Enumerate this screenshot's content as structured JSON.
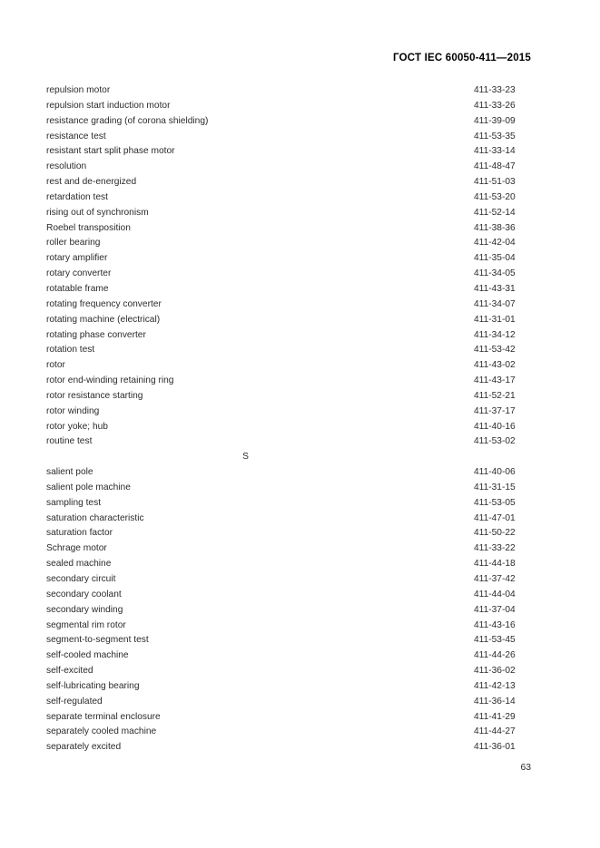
{
  "header": {
    "standard_title": "ГОСТ IEC 60050-411—2015"
  },
  "footer": {
    "page_number": "63"
  },
  "index": {
    "blocks": [
      {
        "letter": null,
        "entries": [
          {
            "term": "repulsion motor",
            "ref": "411-33-23"
          },
          {
            "term": "repulsion start induction motor",
            "ref": "411-33-26"
          },
          {
            "term": "resistance grading (of corona shielding)",
            "ref": "411-39-09"
          },
          {
            "term": "resistance test",
            "ref": "411-53-35"
          },
          {
            "term": "resistant start split phase motor",
            "ref": "411-33-14"
          },
          {
            "term": "resolution",
            "ref": "411-48-47"
          },
          {
            "term": "rest and de-energized",
            "ref": "411-51-03"
          },
          {
            "term": "retardation test",
            "ref": "411-53-20"
          },
          {
            "term": "rising out of synchronism",
            "ref": "411-52-14"
          },
          {
            "term": "Roebel transposition",
            "ref": "411-38-36"
          },
          {
            "term": "roller bearing",
            "ref": "411-42-04"
          },
          {
            "term": "rotary amplifier",
            "ref": "411-35-04"
          },
          {
            "term": "rotary converter",
            "ref": "411-34-05"
          },
          {
            "term": "rotatable frame",
            "ref": "411-43-31"
          },
          {
            "term": "rotating frequency converter",
            "ref": "411-34-07"
          },
          {
            "term": "rotating machine (electrical)",
            "ref": "411-31-01"
          },
          {
            "term": "rotating phase converter",
            "ref": "411-34-12"
          },
          {
            "term": "rotation test",
            "ref": "411-53-42"
          },
          {
            "term": "rotor",
            "ref": "411-43-02"
          },
          {
            "term": "rotor end-winding retaining ring",
            "ref": "411-43-17"
          },
          {
            "term": "rotor resistance starting",
            "ref": "411-52-21"
          },
          {
            "term": "rotor winding",
            "ref": "411-37-17"
          },
          {
            "term": "rotor yoke; hub",
            "ref": "411-40-16"
          },
          {
            "term": "routine test",
            "ref": "411-53-02"
          }
        ]
      },
      {
        "letter": "S",
        "entries": [
          {
            "term": "salient pole",
            "ref": "411-40-06"
          },
          {
            "term": "salient pole machine",
            "ref": "411-31-15"
          },
          {
            "term": "sampling test",
            "ref": "411-53-05"
          },
          {
            "term": "saturation characteristic",
            "ref": "411-47-01"
          },
          {
            "term": "saturation factor",
            "ref": "411-50-22"
          },
          {
            "term": "Schrage motor",
            "ref": "411-33-22"
          },
          {
            "term": "sealed machine",
            "ref": "411-44-18"
          },
          {
            "term": "secondary circuit",
            "ref": "411-37-42"
          },
          {
            "term": "secondary coolant",
            "ref": "411-44-04"
          },
          {
            "term": "secondary winding",
            "ref": "411-37-04"
          },
          {
            "term": "segmental rim rotor",
            "ref": "411-43-16"
          },
          {
            "term": "segment-to-segment test",
            "ref": "411-53-45"
          },
          {
            "term": "self-cooled machine",
            "ref": "411-44-26"
          },
          {
            "term": "self-excited",
            "ref": "411-36-02"
          },
          {
            "term": "self-lubricating bearing",
            "ref": "411-42-13"
          },
          {
            "term": "self-regulated",
            "ref": "411-36-14"
          },
          {
            "term": "separate terminal enclosure",
            "ref": "411-41-29"
          },
          {
            "term": "separately cooled machine",
            "ref": "411-44-27"
          },
          {
            "term": "separately excited",
            "ref": "411-36-01"
          }
        ]
      }
    ]
  }
}
